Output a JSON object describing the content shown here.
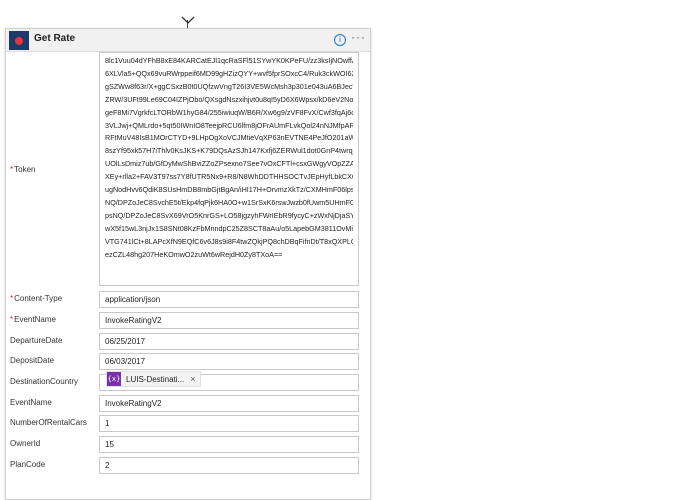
{
  "card": {
    "title": "Get Rate",
    "info_glyph": "i",
    "more_glyph": "···",
    "icon_color": "#e8323c"
  },
  "token": {
    "label": "Token",
    "lines": [
      "8lc1Vuu04dYFhB8xE84KARCatEJl1qcRaSFl51SYwYK0KPeFU/zz3ksIjNOwffAqhP",
      "6XLVla5+QQx69vuRWrppeif6MD99gHZizQYY+wvf5fprSOxcC4/Ruk3ckWOI62",
      "gSZWw8f63r/X+ggCSxzB0t0UQfzwVngT26I3VE5WcMsh3p301e043uA6BJecV8",
      "ZRW/3UFt99Le69C04IZPjObo/QXsgdNszxihjvt0u8qI5yD6X6Wpsx/kD6eV2No",
      "geF8Mi7VgrkfcLTORbW1hyG84/255iwiuqW/B6R/Xw6g9/zVF8FvX/Cwf3fqAj6d",
      "3VLJwj+QMLrdo+5qt50IWnIO8TeejpRCU6lfm8jOFrAUmFLvkQol24nNJMfpAR",
      "RFtMuV48IsB1MOrCTYD+9LHpOgXoVCJMtieVqXP63nEVTNE4PeJfO201aWe8I",
      "8szYf95xk57H7iThlv0KsJKS+K79DQsAzSJh147Kxfj6ZERWul1dot0GnP4twrqj+9",
      "UOlLsDmiz7ub/GfDyMwShBviZZoZPsexno7See7vOxCFTl+csxGWgyVOpZZAfH",
      "XEy+rlla2+FAV3T97ss7Y8fUTR5Nx9+R8/N8WhDDTHHSOCTvJEpHyfLbkCXC3x",
      "ugNodHvv6QdiK8SUsHmDB8mbGjtBgAn/iHI17H+OrvmzXkTz/CXMHmF06lps",
      "NQ/DPZoJeC8SvchE5t/Ekp4fqPjk6HA0O+w1SrSxK6rswJwzb0fUwm5UHmF06l",
      "psNQ/DPZoJeC8SvX69VrO5KnrGS+LO58jgzyhFWrIEbR9fycyC+zWxNjDjaSY2g",
      "wX5f15wL3njJx1S8SNt08KzFbMnndpC25Z8SCT8aAu/o5LapebGM3811OvMi4t",
      "VTG741lCt+8LAPcXfN9EQfC6v6J8s9i8F4twZQkjPQ8chDBqFifnDt/T8xQXPLQYF",
      "ezCZL48hg207HeKOmwO2zuWt6wRejdH0Zy8TXoA=="
    ]
  },
  "fields": [
    {
      "label": "Content-Type",
      "required": true,
      "value": "application/json"
    },
    {
      "label": "EventName",
      "required": true,
      "value": "InvokeRatingV2"
    },
    {
      "label": "DepartureDate",
      "required": false,
      "value": "06/25/2017"
    },
    {
      "label": "DepositDate",
      "required": false,
      "value": "06/03/2017"
    },
    {
      "label": "DestinationCountry",
      "required": false,
      "value": ""
    },
    {
      "label": "EventName",
      "required": false,
      "value": "InvokeRatingV2"
    },
    {
      "label": "NumberOfRentalCars",
      "required": false,
      "value": "1"
    },
    {
      "label": "OwnerId",
      "required": false,
      "value": "15"
    },
    {
      "label": "PlanCode",
      "required": false,
      "value": "2"
    }
  ],
  "chip": {
    "icon_glyph": "{x}",
    "label": "LUIS-Destinati...",
    "close_glyph": "×"
  },
  "required_mark": "*"
}
